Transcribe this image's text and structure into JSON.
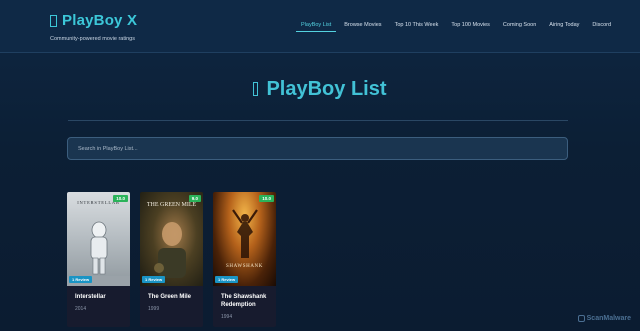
{
  "brand": {
    "title": "PlayBoy X",
    "subtitle": "Community-powered movie ratings"
  },
  "nav": [
    {
      "label": "PlayBoy List",
      "active": true
    },
    {
      "label": "Browse Movies",
      "active": false
    },
    {
      "label": "Top 10 This Week",
      "active": false
    },
    {
      "label": "Top 100 Movies",
      "active": false
    },
    {
      "label": "Coming Soon",
      "active": false
    },
    {
      "label": "Airing Today",
      "active": false
    },
    {
      "label": "Discord",
      "active": false
    }
  ],
  "hero": {
    "title": "PlayBoy List"
  },
  "search": {
    "placeholder": "Search in PlayBoy List..."
  },
  "movies": [
    {
      "title": "Interstellar",
      "year": "2014",
      "rating": "10.0",
      "reviews": "1 Review",
      "poster_text": "INTERSTELLAR"
    },
    {
      "title": "The Green Mile",
      "year": "1999",
      "rating": "9.0",
      "reviews": "1 Review",
      "poster_text": "THE GREEN MILE"
    },
    {
      "title": "The Shawshank Redemption",
      "year": "1994",
      "rating": "10.0",
      "reviews": "1 Review",
      "poster_text": "SHAWSHANK"
    }
  ],
  "watermark": {
    "text": "ScanMalware"
  },
  "colors": {
    "accent": "#42c2d6",
    "rating": "#2bb35a",
    "reviews": "#1a94c4"
  }
}
